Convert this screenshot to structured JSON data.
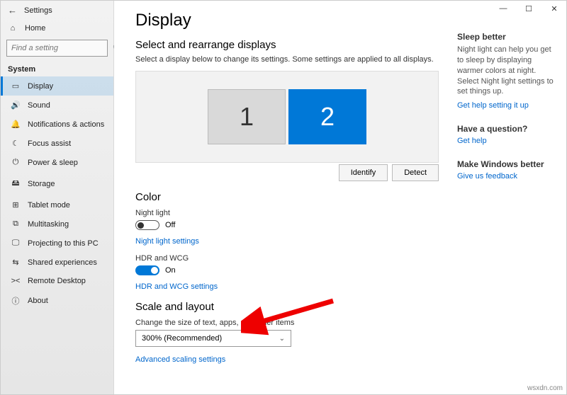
{
  "window": {
    "app_title": "Settings"
  },
  "titlebar": {
    "min": "—",
    "max": "☐",
    "close": "✕"
  },
  "sidebar": {
    "home": "Home",
    "search_placeholder": "Find a setting",
    "heading": "System",
    "items": [
      {
        "icon": "▭",
        "label": "Display",
        "active": true
      },
      {
        "icon": "🔊",
        "label": "Sound"
      },
      {
        "icon": "🔔",
        "label": "Notifications & actions"
      },
      {
        "icon": "☾",
        "label": "Focus assist"
      },
      {
        "icon": "⏻",
        "label": "Power & sleep"
      },
      {
        "icon": "🖴",
        "label": "Storage"
      },
      {
        "icon": "⊞",
        "label": "Tablet mode"
      },
      {
        "icon": "⧉",
        "label": "Multitasking"
      },
      {
        "icon": "🖵",
        "label": "Projecting to this PC"
      },
      {
        "icon": "⇆",
        "label": "Shared experiences"
      },
      {
        "icon": "><",
        "label": "Remote Desktop"
      },
      {
        "icon": "ⓘ",
        "label": "About"
      }
    ]
  },
  "content": {
    "title": "Display",
    "rearrange_heading": "Select and rearrange displays",
    "rearrange_desc": "Select a display below to change its settings. Some settings are applied to all displays.",
    "monitors": {
      "m1": "1",
      "m2": "2"
    },
    "identify": "Identify",
    "detect": "Detect",
    "color_heading": "Color",
    "night_light_label": "Night light",
    "night_light_state": "Off",
    "night_light_link": "Night light settings",
    "hdr_label": "HDR and WCG",
    "hdr_state": "On",
    "hdr_link": "HDR and WCG settings",
    "scale_heading": "Scale and layout",
    "scale_desc": "Change the size of text, apps, and other items",
    "scale_value": "300% (Recommended)",
    "adv_scaling": "Advanced scaling settings"
  },
  "right": {
    "sleep_h": "Sleep better",
    "sleep_p": "Night light can help you get to sleep by displaying warmer colors at night. Select Night light settings to set things up.",
    "sleep_link": "Get help setting it up",
    "q_h": "Have a question?",
    "q_link": "Get help",
    "fb_h": "Make Windows better",
    "fb_link": "Give us feedback"
  },
  "watermark": "wsxdn.com"
}
